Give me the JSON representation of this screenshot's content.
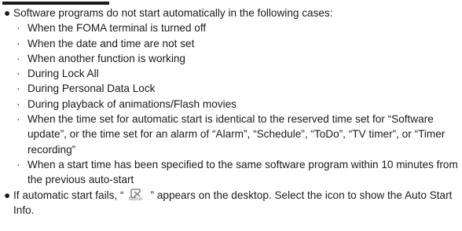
{
  "bullet": "●",
  "midDot": "·",
  "intro": "Software programs do not start automatically in the following cases:",
  "cases": [
    "When the FOMA terminal is turned off",
    "When the date and time are not set",
    "When another function is working",
    "During Lock All",
    "During Personal Data Lock",
    "During playback of animations/Flash movies",
    "When the time set for automatic start is identical to the reserved time set for “Software update”, or the time set for an alarm of “Alarm”, “Schedule”, “ToDo”, “TV timer”, or “Timer recording”",
    "When a start time has been specified to the same software program within 10 minutes from the previous auto-start"
  ],
  "failNote": {
    "before": "If automatic start fails, “",
    "iconLabel": "Notrun",
    "after": "” appears on the desktop. Select the icon to show the Auto Start Info."
  },
  "colors": {
    "text": "#1a1a1a",
    "icon": "#8a8a8a"
  }
}
